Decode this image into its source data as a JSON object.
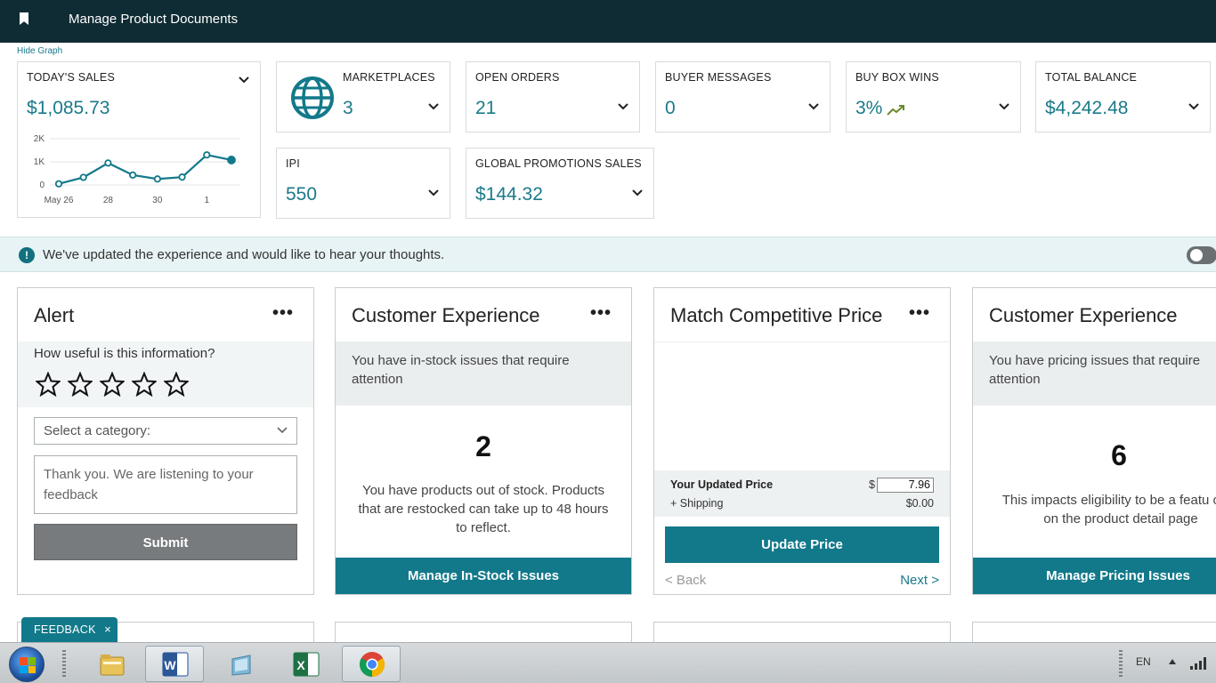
{
  "header": {
    "title": "Manage Product Documents"
  },
  "graph_toggle": "Hide Graph",
  "metrics": {
    "todays_sales": {
      "label": "TODAY'S SALES",
      "value": "$1,085.73"
    },
    "marketplaces": {
      "label": "MARKETPLACES",
      "value": "3"
    },
    "open_orders": {
      "label": "OPEN ORDERS",
      "value": "21"
    },
    "buyer_messages": {
      "label": "BUYER MESSAGES",
      "value": "0"
    },
    "buy_box_wins": {
      "label": "BUY BOX WINS",
      "value": "3%"
    },
    "total_balance": {
      "label": "TOTAL BALANCE",
      "value": "$4,242.48"
    },
    "ipi": {
      "label": "IPI",
      "value": "550"
    },
    "global_promotions": {
      "label": "GLOBAL PROMOTIONS SALES",
      "value": "$144.32"
    }
  },
  "chart_data": {
    "type": "line",
    "title": "",
    "xlabel": "",
    "ylabel": "",
    "ylim": [
      0,
      2000
    ],
    "yticks": [
      "0",
      "1K",
      "2K"
    ],
    "xticks": [
      "May 26",
      "28",
      "30",
      "1"
    ],
    "x": [
      "May 26",
      "May 27",
      "May 28",
      "May 29",
      "May 30",
      "May 31",
      "Jun 1",
      "Jun 2"
    ],
    "values": [
      50,
      330,
      950,
      430,
      260,
      340,
      1300,
      1080
    ],
    "color": "#12798a",
    "grid": true
  },
  "banner": {
    "message": "We've updated the experience and would like to hear your thoughts."
  },
  "widgets": {
    "alert": {
      "title": "Alert",
      "question": "How useful is this information?",
      "rating": 0,
      "category_placeholder": "Select a category:",
      "feedback_text": "Thank you. We are listening to your feedback",
      "submit": "Submit"
    },
    "customer_exp_1": {
      "title": "Customer Experience",
      "notice": "You have in-stock issues that require attention",
      "count": "2",
      "description": "You have products out of stock. Products that are restocked can take up to 48 hours to reflect.",
      "action": "Manage In-Stock Issues"
    },
    "match_price": {
      "title": "Match Competitive Price",
      "updated_price_label": "Your Updated Price",
      "currency": "$",
      "price": "7.96",
      "shipping_label": "+ Shipping",
      "shipping": "$0.00",
      "update_button": "Update Price",
      "back": "< Back",
      "next": "Next >"
    },
    "customer_exp_2": {
      "title": "Customer Experience",
      "notice": "You have pricing issues that require attention",
      "count": "6",
      "description": "This impacts eligibility to be a featu offer on the product detail page",
      "action": "Manage Pricing Issues"
    }
  },
  "feedback_tab": {
    "label": "FEEDBACK",
    "close": "×"
  },
  "taskbar": {
    "language": "EN",
    "apps": [
      "explorer-icon",
      "word-icon",
      "generic-app-icon",
      "excel-icon",
      "chrome-icon"
    ]
  },
  "colors": {
    "brand_teal": "#12798a",
    "header": "#0f2b33",
    "accent_text": "#1a7a8a"
  }
}
